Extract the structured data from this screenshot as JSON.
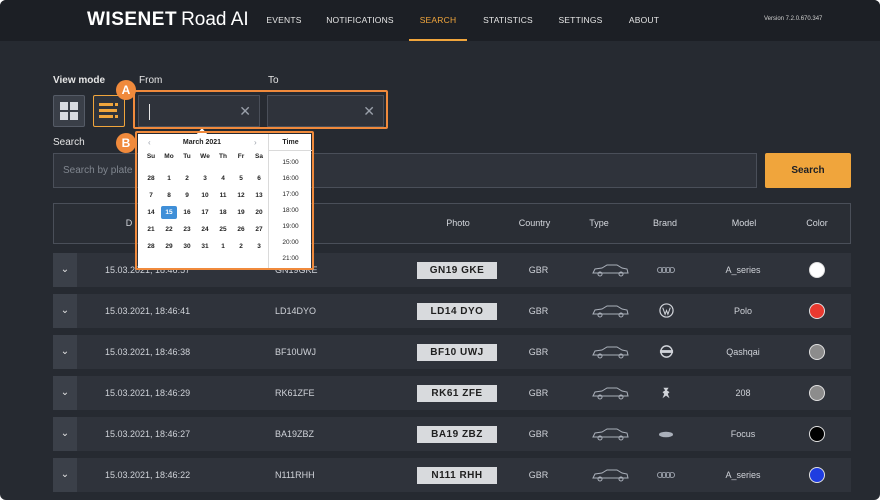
{
  "app": {
    "logo_brand": "WISENET",
    "logo_product": "Road AI",
    "version": "Version 7.2.0.670.347"
  },
  "nav": [
    {
      "label": "EVENTS"
    },
    {
      "label": "NOTIFICATIONS"
    },
    {
      "label": "SEARCH",
      "active": true
    },
    {
      "label": "STATISTICS"
    },
    {
      "label": "SETTINGS"
    },
    {
      "label": "ABOUT"
    }
  ],
  "filters": {
    "view_mode_label": "View mode",
    "from_label": "From",
    "to_label": "To",
    "from_value": "",
    "to_value": "",
    "search_label": "Search",
    "search_placeholder": "Search by plate",
    "search_button": "Search"
  },
  "callouts": {
    "a": "A",
    "b": "B"
  },
  "calendar": {
    "month": "March 2021",
    "prev": "‹",
    "next": "›",
    "weekdays": [
      "Su",
      "Mo",
      "Tu",
      "We",
      "Th",
      "Fr",
      "Sa"
    ],
    "weeks": [
      [
        "28",
        "1",
        "2",
        "3",
        "4",
        "5",
        "6"
      ],
      [
        "7",
        "8",
        "9",
        "10",
        "11",
        "12",
        "13"
      ],
      [
        "14",
        "15",
        "16",
        "17",
        "18",
        "19",
        "20"
      ],
      [
        "21",
        "22",
        "23",
        "24",
        "25",
        "26",
        "27"
      ],
      [
        "28",
        "29",
        "30",
        "31",
        "1",
        "2",
        "3"
      ]
    ],
    "selected_day": "15",
    "time_header": "Time",
    "times": [
      "15:00",
      "16:00",
      "17:00",
      "18:00",
      "19:00",
      "20:00",
      "21:00"
    ]
  },
  "table": {
    "headers": {
      "date": "D",
      "photo": "Photo",
      "country": "Country",
      "type": "Type",
      "brand": "Brand",
      "model": "Model",
      "color": "Color"
    },
    "rows": [
      {
        "date": "15.03.2021, 18:46:57",
        "plate": "GN19GKE",
        "photo": "GN19 GKE",
        "country": "GBR",
        "brand_icon": "audi-rings-icon",
        "model": "A_series",
        "color": "#ffffff"
      },
      {
        "date": "15.03.2021, 18:46:41",
        "plate": "LD14DYO",
        "photo": "LD14 DYO",
        "country": "GBR",
        "brand_icon": "volkswagen-logo-icon",
        "model": "Polo",
        "color": "#e8392f"
      },
      {
        "date": "15.03.2021, 18:46:38",
        "plate": "BF10UWJ",
        "photo": "BF10 UWJ",
        "country": "GBR",
        "brand_icon": "nissan-logo-icon",
        "model": "Qashqai",
        "color": "#8c8c8c"
      },
      {
        "date": "15.03.2021, 18:46:29",
        "plate": "RK61ZFE",
        "photo": "RK61 ZFE",
        "country": "GBR",
        "brand_icon": "peugeot-lion-icon",
        "model": "208",
        "color": "#8c8c8c"
      },
      {
        "date": "15.03.2021, 18:46:27",
        "plate": "BA19ZBZ",
        "photo": "BA19 ZBZ",
        "country": "GBR",
        "brand_icon": "ford-oval-icon",
        "model": "Focus",
        "color": "#000000"
      },
      {
        "date": "15.03.2021, 18:46:22",
        "plate": "N111RHH",
        "photo": "N111 RHH",
        "country": "GBR",
        "brand_icon": "audi-rings-icon",
        "model": "A_series",
        "color": "#1f3de0"
      }
    ]
  },
  "colors": {
    "accent": "#f0a53c",
    "callout": "#f08a3c",
    "selected_day": "#3f8fd8"
  }
}
